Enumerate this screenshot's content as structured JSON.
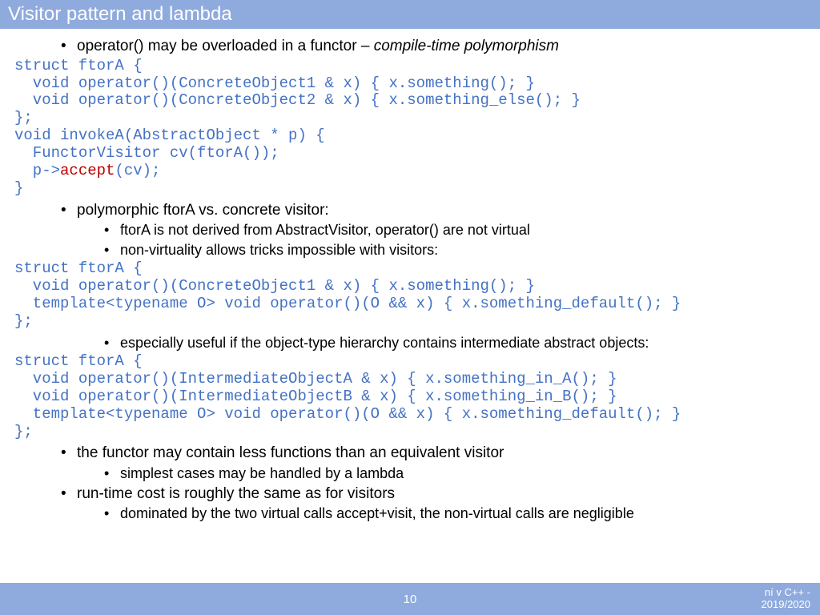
{
  "title": "Visitor pattern and lambda",
  "bullets": {
    "b1": "operator() may be overloaded in a functor – ",
    "b1_italic": "compile-time polymorphism",
    "b2": "polymorphic ftorA vs. concrete visitor:",
    "b2a": "ftorA is not derived from AbstractVisitor, operator() are not virtual",
    "b2b": "non-virtuality allows tricks impossible with visitors:",
    "b2c": "especially useful if the object-type hierarchy contains intermediate abstract objects:",
    "b3": "the functor may contain less functions than an equivalent visitor",
    "b3a": "simplest cases may be handled by a lambda",
    "b4": "run-time cost is roughly the same as for visitors",
    "b4a": "dominated by the two virtual calls accept+visit, the non-virtual calls are negligible"
  },
  "code1": {
    "l1": "struct ftorA {",
    "l2": "  void operator()(ConcreteObject1 & x) { x.something(); }",
    "l3": "  void operator()(ConcreteObject2 & x) { x.something_else(); }",
    "l4": "};",
    "l5": "void invokeA(AbstractObject * p) {",
    "l6": "  FunctorVisitor cv(ftorA());",
    "l7a": "  p->",
    "l7b": "accept",
    "l7c": "(cv);",
    "l8": "}"
  },
  "code2": {
    "l1": "struct ftorA {",
    "l2": "  void operator()(ConcreteObject1 & x) { x.something(); }",
    "l3": "  template<typename O> void operator()(O && x) { x.something_default(); }",
    "l4": "};"
  },
  "code3": {
    "l1": "struct ftorA {",
    "l2": "  void operator()(IntermediateObjectA & x) { x.something_in_A(); }",
    "l3": "  void operator()(IntermediateObjectB & x) { x.something_in_B(); }",
    "l4": "  template<typename O> void operator()(O && x) { x.something_default(); }",
    "l5": "};"
  },
  "footer": {
    "page": "10",
    "right1": "ní v C++ -",
    "right2": "2019/2020"
  }
}
